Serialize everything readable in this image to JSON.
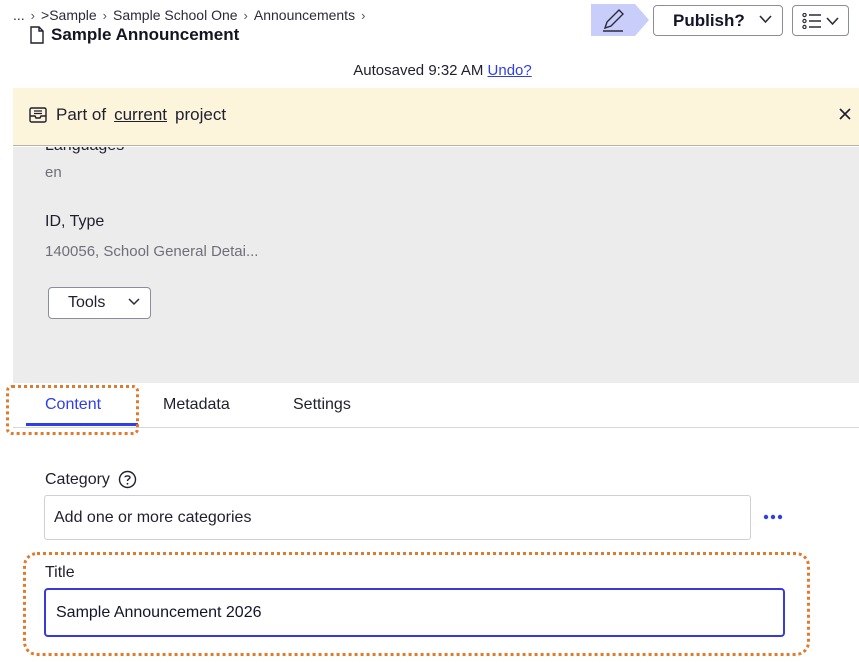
{
  "breadcrumb": {
    "items": [
      "...",
      ">Sample",
      "Sample School One",
      "Announcements"
    ]
  },
  "document": {
    "title": "Sample Announcement"
  },
  "toolbar": {
    "publish_label": "Publish?",
    "edit_icon": "pencil-icon",
    "view_icon": "list-view-icon"
  },
  "autosave": {
    "text": "Autosaved 9:32 AM",
    "undo_label": "Undo?"
  },
  "banner": {
    "prefix": "Part of",
    "link": "current",
    "suffix": "project",
    "close_icon": "close-icon"
  },
  "details": {
    "languages_label": "Languages",
    "languages_value": "en",
    "id_type_label": "ID, Type",
    "id_type_value": "140056, School General Detai...",
    "tools_label": "Tools"
  },
  "tabs": [
    {
      "label": "Content",
      "active": true
    },
    {
      "label": "Metadata",
      "active": false
    },
    {
      "label": "Settings",
      "active": false
    }
  ],
  "form": {
    "category_label": "Category",
    "category_placeholder": "Add one or more categories",
    "title_label": "Title",
    "title_value": "Sample Announcement 2026"
  },
  "colors": {
    "accent": "#2e3ee8",
    "banner_bg": "#fdf4dc",
    "panel_bg": "#ececec",
    "focus_ring": "#e07b2e"
  }
}
